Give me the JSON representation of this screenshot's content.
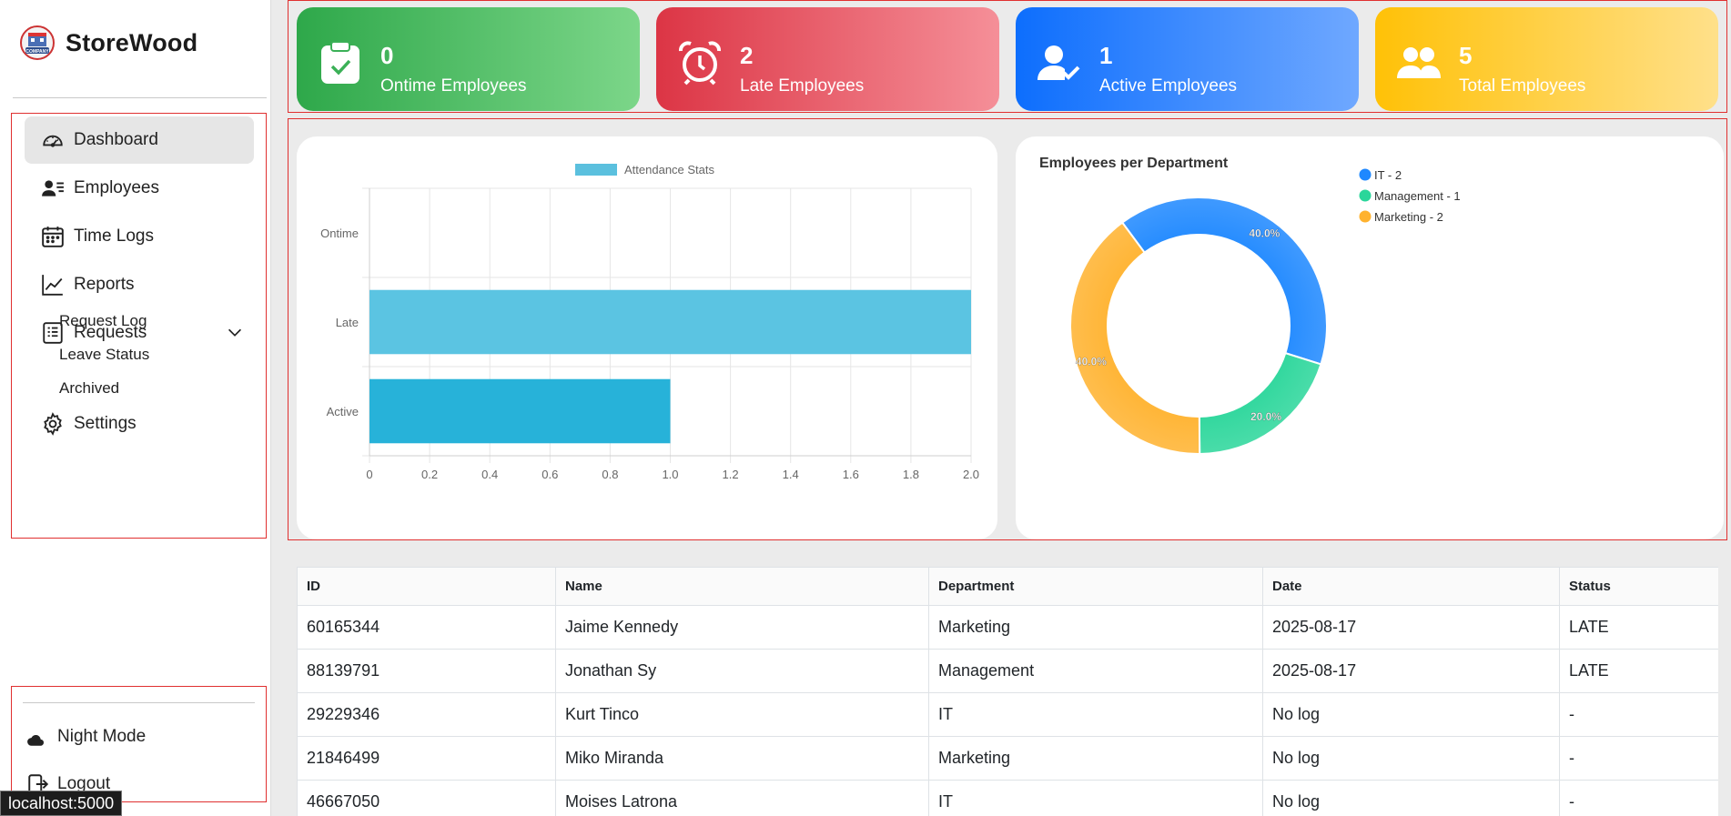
{
  "brand": {
    "name": "StoreWood",
    "logo_text": "COMPANY"
  },
  "nav": {
    "dashboard": "Dashboard",
    "employees": "Employees",
    "time_logs": "Time Logs",
    "reports": "Reports",
    "requests": "Requests",
    "sub": {
      "request_log": "Request Log",
      "leave_status": "Leave Status",
      "archived": "Archived"
    },
    "settings": "Settings",
    "night_mode": "Night Mode",
    "logout": "Logout"
  },
  "status_url": "localhost:5000",
  "cards": [
    {
      "value": "0",
      "label": "Ontime Employees",
      "icon": "clipboard-check-icon"
    },
    {
      "value": "2",
      "label": "Late Employees",
      "icon": "alarm-clock-icon"
    },
    {
      "value": "1",
      "label": "Active Employees",
      "icon": "user-check-icon"
    },
    {
      "value": "5",
      "label": "Total Employees",
      "icon": "users-icon"
    }
  ],
  "colors": {
    "accent_green": "#2ea84a",
    "accent_red": "#dc3545",
    "accent_blue": "#0d6efd",
    "accent_yellow": "#ffc107"
  },
  "chart_data": [
    {
      "type": "bar",
      "orientation": "horizontal",
      "categories": [
        "Ontime",
        "Late",
        "Active"
      ],
      "series": [
        {
          "name": "Attendance Stats",
          "values": [
            0,
            2,
            1
          ],
          "colors": [
            "#5bc0de",
            "#5bc4e2",
            "#27b2d9"
          ]
        }
      ],
      "x_ticks": [
        "0",
        "0.2",
        "0.4",
        "0.6",
        "0.8",
        "1.0",
        "1.2",
        "1.4",
        "1.6",
        "1.8",
        "2.0"
      ],
      "xlim": [
        0,
        2
      ],
      "grid": true,
      "legend": "top-center"
    },
    {
      "type": "pie",
      "variant": "doughnut",
      "title": "Employees per Department",
      "slices": [
        {
          "label": "IT - 2",
          "value": 2,
          "percent": "40.0%",
          "color": "#1e88ff"
        },
        {
          "label": "Management - 1",
          "value": 1,
          "percent": "20.0%",
          "color": "#2ad69a"
        },
        {
          "label": "Marketing - 2",
          "value": 2,
          "percent": "40.0%",
          "color": "#ffb22e"
        }
      ],
      "legend": "right"
    }
  ],
  "table": {
    "headers": [
      "ID",
      "Name",
      "Department",
      "Date",
      "Status"
    ],
    "rows": [
      [
        "60165344",
        "Jaime Kennedy",
        "Marketing",
        "2025-08-17",
        "LATE"
      ],
      [
        "88139791",
        "Jonathan Sy",
        "Management",
        "2025-08-17",
        "LATE"
      ],
      [
        "29229346",
        "Kurt Tinco",
        "IT",
        "No log",
        "-"
      ],
      [
        "21846499",
        "Miko Miranda",
        "Marketing",
        "No log",
        "-"
      ],
      [
        "46667050",
        "Moises Latrona",
        "IT",
        "No log",
        "-"
      ]
    ]
  }
}
